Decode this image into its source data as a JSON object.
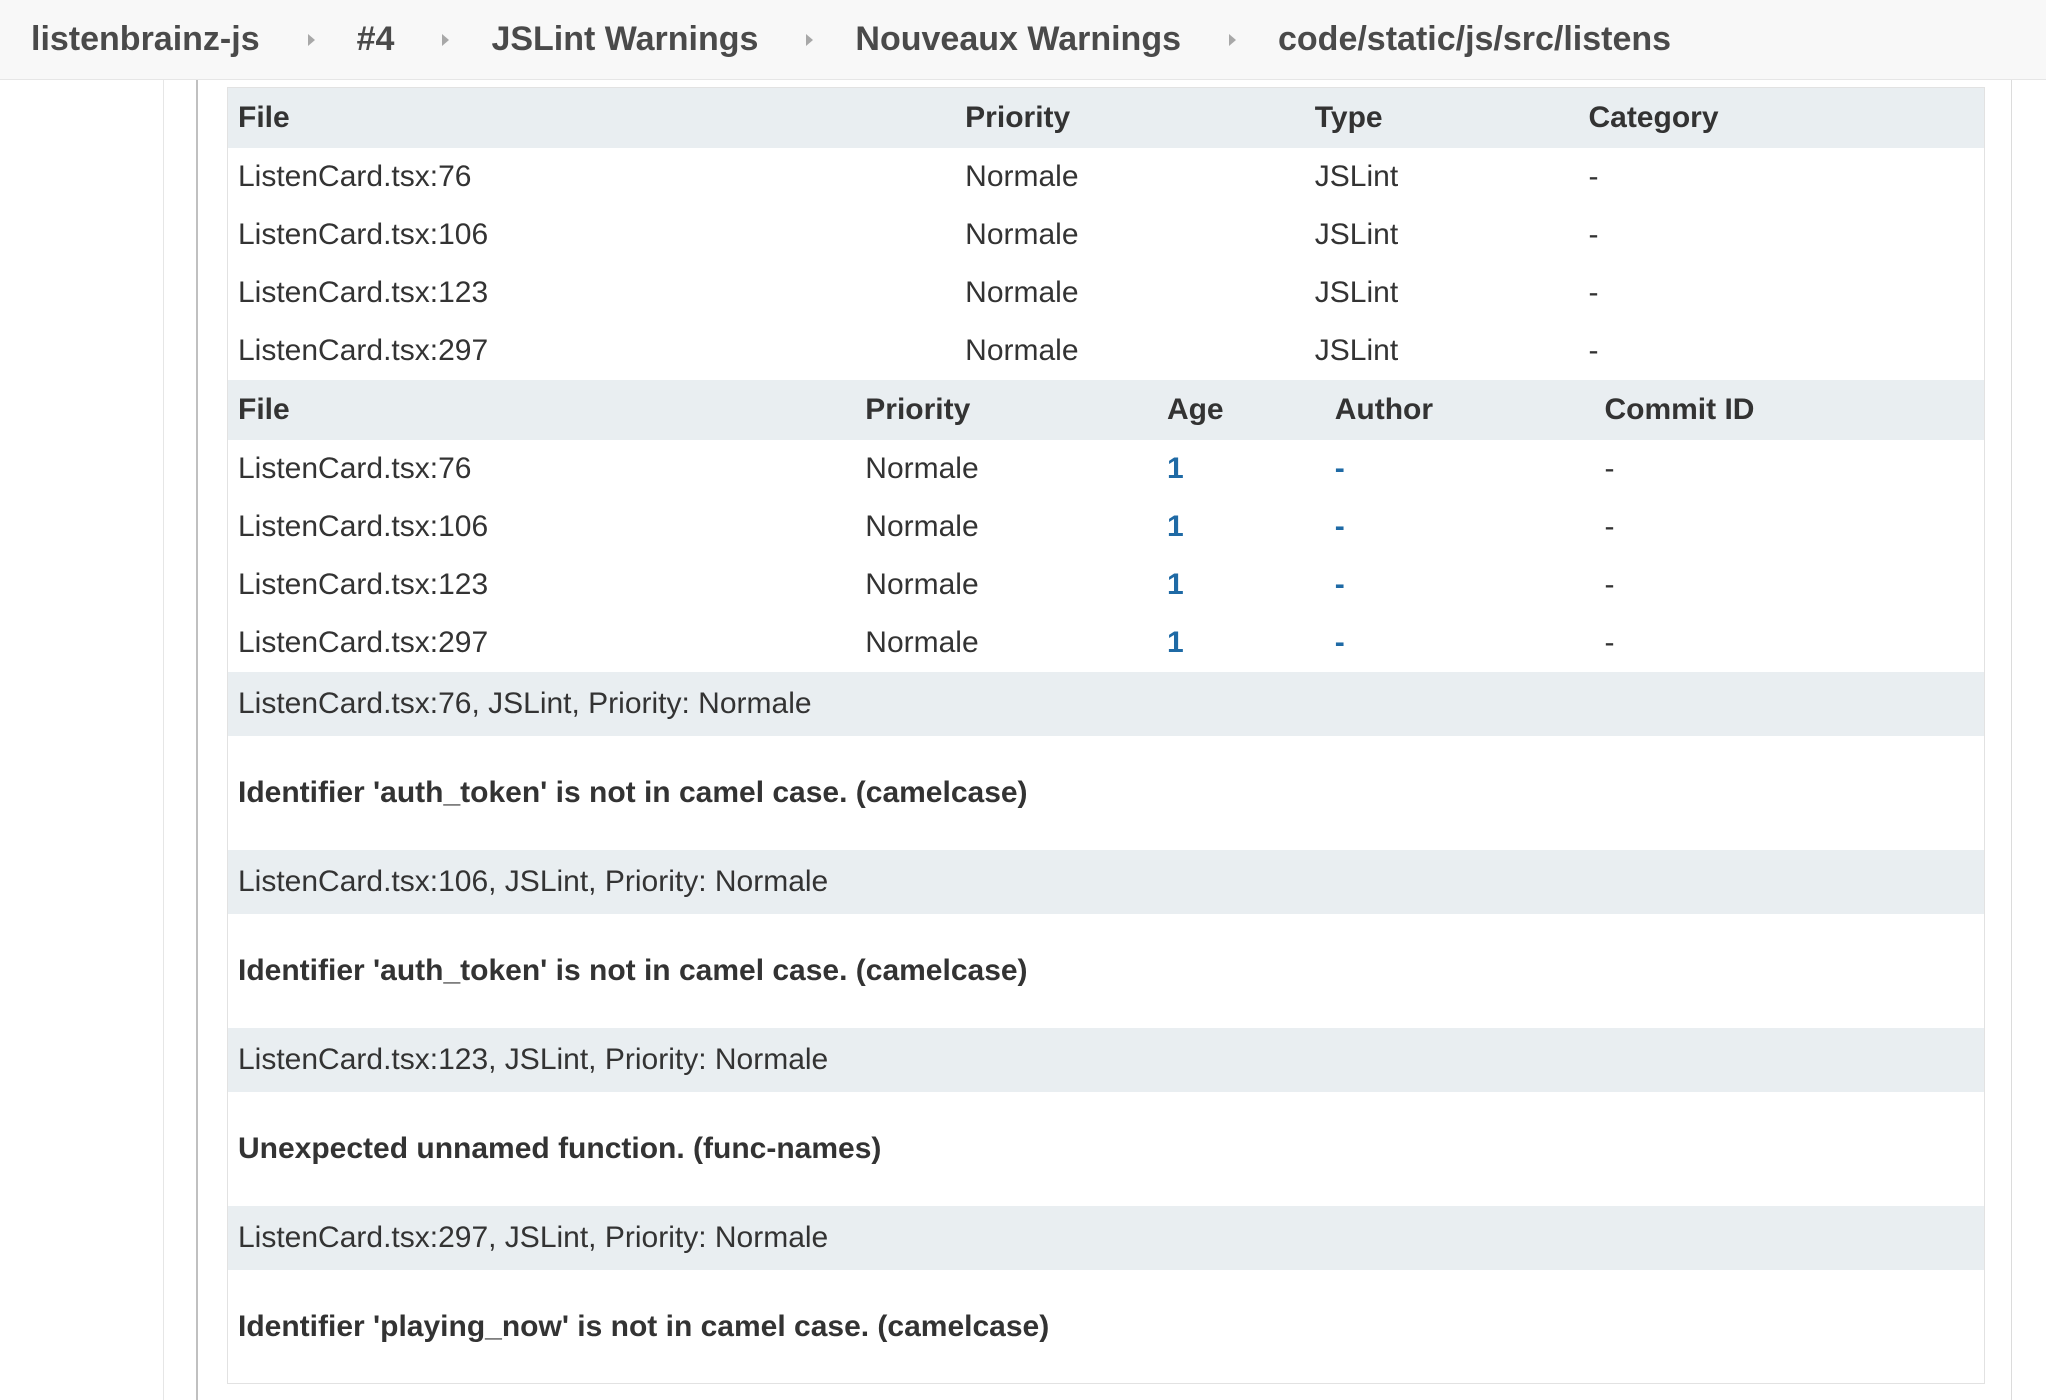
{
  "breadcrumb": [
    "listenbrainz-js",
    "#4",
    "JSLint Warnings",
    "Nouveaux Warnings",
    "code/static/js/src/listens"
  ],
  "table1": {
    "headers": [
      "File",
      "Priority",
      "Type",
      "Category"
    ],
    "rows": [
      [
        "ListenCard.tsx:76",
        "Normale",
        "JSLint",
        "-"
      ],
      [
        "ListenCard.tsx:106",
        "Normale",
        "JSLint",
        "-"
      ],
      [
        "ListenCard.tsx:123",
        "Normale",
        "JSLint",
        "-"
      ],
      [
        "ListenCard.tsx:297",
        "Normale",
        "JSLint",
        "-"
      ]
    ]
  },
  "table2": {
    "headers": [
      "File",
      "Priority",
      "Age",
      "Author",
      "Commit ID"
    ],
    "rows": [
      [
        "ListenCard.tsx:76",
        "Normale",
        "1",
        "-",
        "-"
      ],
      [
        "ListenCard.tsx:106",
        "Normale",
        "1",
        "-",
        "-"
      ],
      [
        "ListenCard.tsx:123",
        "Normale",
        "1",
        "-",
        "-"
      ],
      [
        "ListenCard.tsx:297",
        "Normale",
        "1",
        "-",
        "-"
      ]
    ]
  },
  "details": [
    {
      "header": "ListenCard.tsx:76, JSLint, Priority: Normale",
      "message": "Identifier 'auth_token' is not in camel case. (camelcase)"
    },
    {
      "header": "ListenCard.tsx:106, JSLint, Priority: Normale",
      "message": "Identifier 'auth_token' is not in camel case. (camelcase)"
    },
    {
      "header": "ListenCard.tsx:123, JSLint, Priority: Normale",
      "message": "Unexpected unnamed function. (func-names)"
    },
    {
      "header": "ListenCard.tsx:297, JSLint, Priority: Normale",
      "message": "Identifier 'playing_now' is not in camel case. (camelcase)"
    }
  ],
  "colors": {
    "header_bg": "#e9eef1",
    "link": "#1f6aa5",
    "breadcrumb_bg": "#f8f8f8"
  }
}
